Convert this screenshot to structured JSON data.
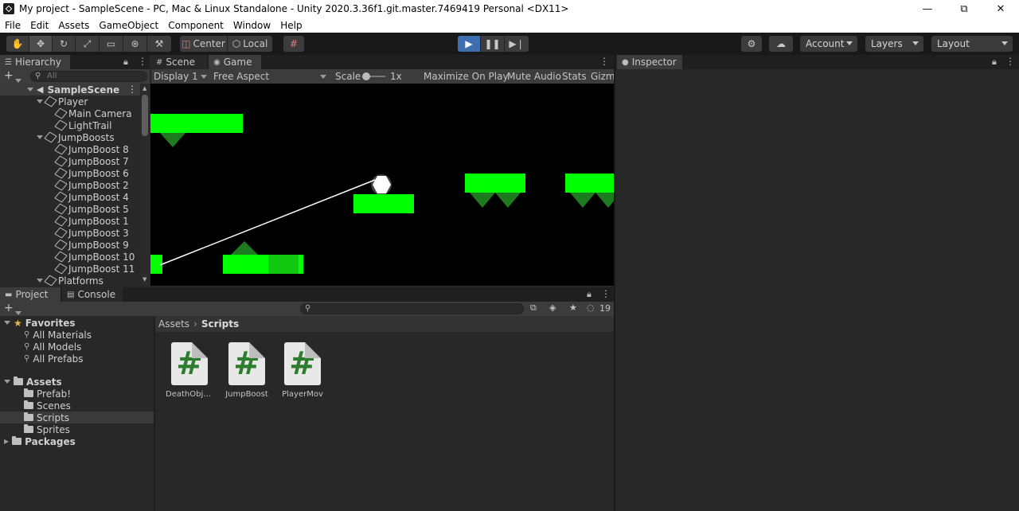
{
  "window": {
    "title": "My project - SampleScene - PC, Mac & Linux Standalone - Unity 2020.3.36f1.git.master.7469419 Personal <DX11>",
    "minimize": "—",
    "maximize": "⧉",
    "close": "✕"
  },
  "menu": [
    "File",
    "Edit",
    "Assets",
    "GameObject",
    "Component",
    "Window",
    "Help"
  ],
  "toolbar": {
    "pivot": "Center",
    "space": "Local",
    "account": "Account",
    "layers": "Layers",
    "layout": "Layout"
  },
  "hierarchy": {
    "tab": "Hierarchy",
    "search_placeholder": "All",
    "scene": "SampleScene",
    "rows": [
      {
        "label": "Player",
        "indent": 1,
        "fold": true
      },
      {
        "label": "Main Camera",
        "indent": 2,
        "fold": false
      },
      {
        "label": "LightTrail",
        "indent": 2,
        "fold": false
      },
      {
        "label": "JumpBoosts",
        "indent": 1,
        "fold": true
      },
      {
        "label": "JumpBoost 8",
        "indent": 2,
        "fold": false
      },
      {
        "label": "JumpBoost 7",
        "indent": 2,
        "fold": false
      },
      {
        "label": "JumpBoost 6",
        "indent": 2,
        "fold": false
      },
      {
        "label": "JumpBoost 2",
        "indent": 2,
        "fold": false
      },
      {
        "label": "JumpBoost 4",
        "indent": 2,
        "fold": false
      },
      {
        "label": "JumpBoost 5",
        "indent": 2,
        "fold": false
      },
      {
        "label": "JumpBoost 1",
        "indent": 2,
        "fold": false
      },
      {
        "label": "JumpBoost 3",
        "indent": 2,
        "fold": false
      },
      {
        "label": "JumpBoost 9",
        "indent": 2,
        "fold": false
      },
      {
        "label": "JumpBoost 10",
        "indent": 2,
        "fold": false
      },
      {
        "label": "JumpBoost 11",
        "indent": 2,
        "fold": false
      },
      {
        "label": "Platforms",
        "indent": 1,
        "fold": true
      }
    ]
  },
  "game_view": {
    "tab_scene": "Scene",
    "tab_game": "Game",
    "display": "Display 1",
    "aspect": "Free Aspect",
    "scale_label": "Scale",
    "scale_value": "1x",
    "maximize": "Maximize On Play",
    "mute": "Mute Audio",
    "stats": "Stats",
    "gizmos": "Gizmos"
  },
  "inspector": {
    "tab": "Inspector"
  },
  "project": {
    "tab_project": "Project",
    "tab_console": "Console",
    "hidden_count": "19",
    "favorites_label": "Favorites",
    "favorites": [
      "All Materials",
      "All Models",
      "All Prefabs"
    ],
    "assets_label": "Assets",
    "asset_folders": [
      "Prefab!",
      "Scenes",
      "Scripts",
      "Sprites"
    ],
    "packages_label": "Packages",
    "breadcrumb_root": "Assets",
    "breadcrumb_current": "Scripts",
    "scripts": [
      "DeathObje...",
      "JumpBoost",
      "PlayerMov"
    ],
    "script_glyph": "#"
  },
  "colors": {
    "platform": "#00ff00",
    "spike": "#1e7a1e",
    "accent": "#3d6fb0",
    "bg": "#282828"
  }
}
